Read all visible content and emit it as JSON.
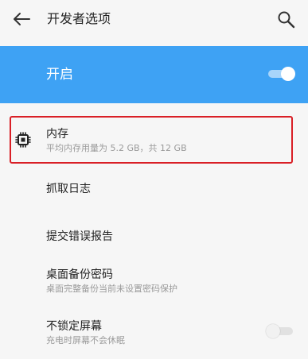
{
  "header": {
    "title": "开发者选项",
    "back_icon": "arrow-left-icon",
    "search_icon": "search-icon"
  },
  "developer_toggle": {
    "label": "开启",
    "enabled": true,
    "bar_color": "#3ea2f4"
  },
  "settings": [
    {
      "title": "内存",
      "subtitle": "平均内存用量为 5.2 GB，共 12 GB",
      "icon": "memory-chip-icon",
      "highlighted": true,
      "highlight_color": "#d91f26"
    },
    {
      "title": "抓取日志"
    },
    {
      "title": "提交错误报告"
    },
    {
      "title": "桌面备份密码",
      "subtitle": "桌面完整备份当前未设置密码保护"
    },
    {
      "title": "不锁定屏幕",
      "subtitle": "充电时屏幕不会休眠",
      "toggle_on": false
    }
  ]
}
